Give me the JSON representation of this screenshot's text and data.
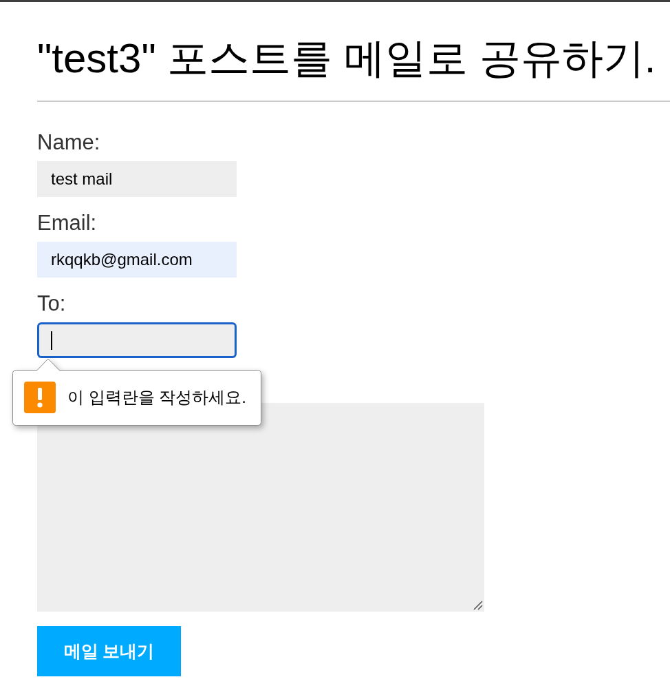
{
  "title": "\"test3\" 포스트를 메일로 공유하기.",
  "fields": [
    {
      "label": "Name:",
      "value": "test mail",
      "autofilled": false,
      "focused": false
    },
    {
      "label": "Email:",
      "value": "rkqqkb@gmail.com",
      "autofilled": true,
      "focused": false
    },
    {
      "label": "To:",
      "autofilled": false,
      "focused": true,
      "error": "이 입력란을 작성하세요."
    }
  ],
  "message_box": {
    "focused": false
  },
  "submit_button": {
    "label": "메일 보내기"
  }
}
